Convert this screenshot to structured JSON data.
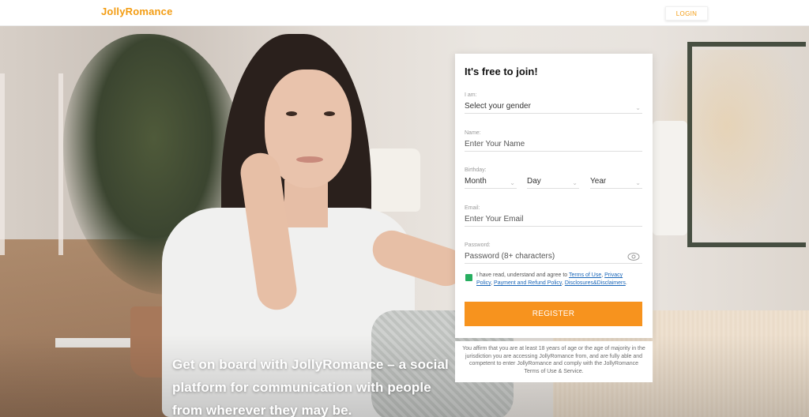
{
  "header": {
    "logo_text": "JollyRomance",
    "login_label": "LOGIN"
  },
  "hero": {
    "tagline": "Get on board with JollyRomance – a social platform for communication with people from wherever they may be."
  },
  "form": {
    "title": "It's free to join!",
    "gender": {
      "label": "I am:",
      "value": "Select your gender"
    },
    "name": {
      "label": "Name:",
      "placeholder": "Enter Your Name"
    },
    "birthday": {
      "label": "Birthday:",
      "month": "Month",
      "day": "Day",
      "year": "Year"
    },
    "email": {
      "label": "Email:",
      "placeholder": "Enter Your Email"
    },
    "password": {
      "label": "Password:",
      "placeholder": "Password (8+ characters)"
    },
    "terms": {
      "prefix": "I have read, understand and agree to ",
      "link1": "Terms of Use",
      "sep1": ", ",
      "link2": "Privacy Policy",
      "sep2": ", ",
      "link3": "Payment and Refund Policy",
      "sep3": ", ",
      "link4": "Disclosures&Disclaimers",
      "suffix": "."
    },
    "register_label": "REGISTER"
  },
  "disclaimer": "You affirm that you are at least 18 years of age or the age of majority in the jurisdiction you are accessing JollyRomance from, and are fully able and competent to enter JollyRomance and comply with the JollyRomance Terms of Use & Service.",
  "colors": {
    "brand_orange": "#f7931e",
    "checkbox_green": "#27ae60",
    "link_blue": "#1a66b8"
  }
}
